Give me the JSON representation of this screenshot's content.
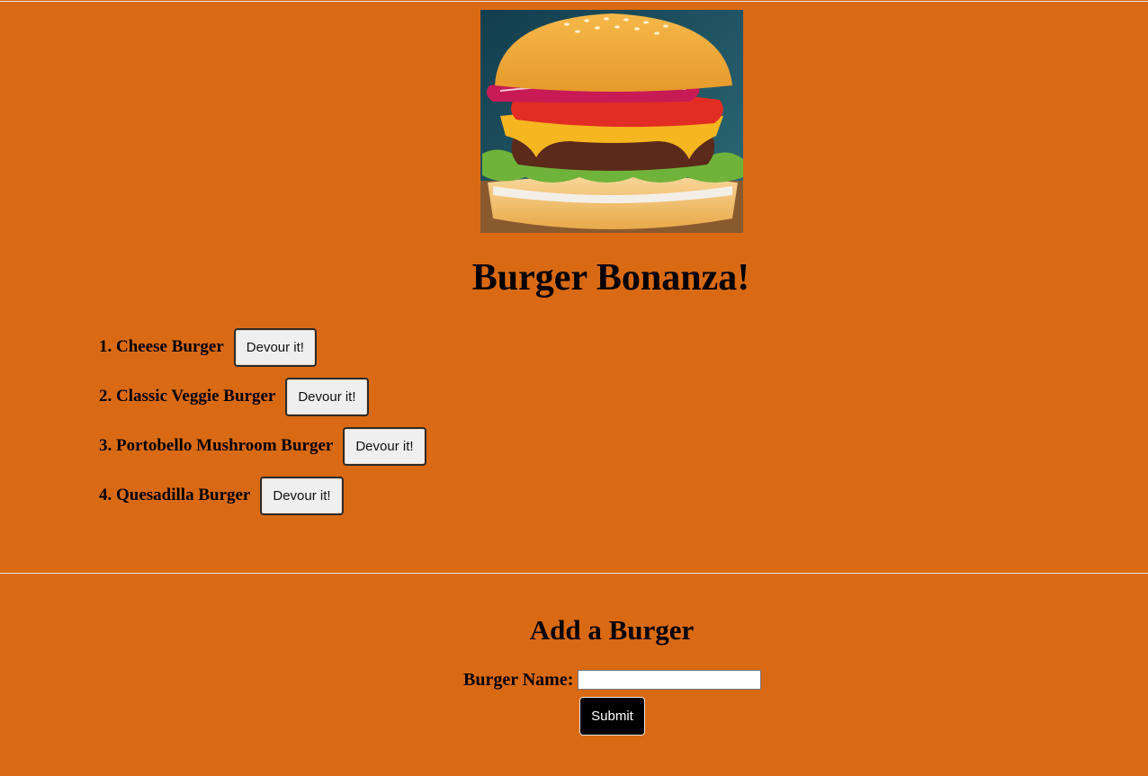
{
  "page": {
    "title": "Burger Bonanza!"
  },
  "burgers": [
    {
      "num": "1.",
      "name": "Cheese Burger",
      "action": "Devour it!"
    },
    {
      "num": "2.",
      "name": "Classic Veggie Burger",
      "action": "Devour it!"
    },
    {
      "num": "3.",
      "name": "Portobello Mushroom Burger",
      "action": "Devour it!"
    },
    {
      "num": "4.",
      "name": "Quesadilla Burger",
      "action": "Devour it!"
    }
  ],
  "add_form": {
    "title": "Add a Burger",
    "label": "Burger Name:",
    "value": "",
    "submit_label": "Submit"
  },
  "colors": {
    "background": "#d96a13",
    "submit_bg": "#000000"
  }
}
